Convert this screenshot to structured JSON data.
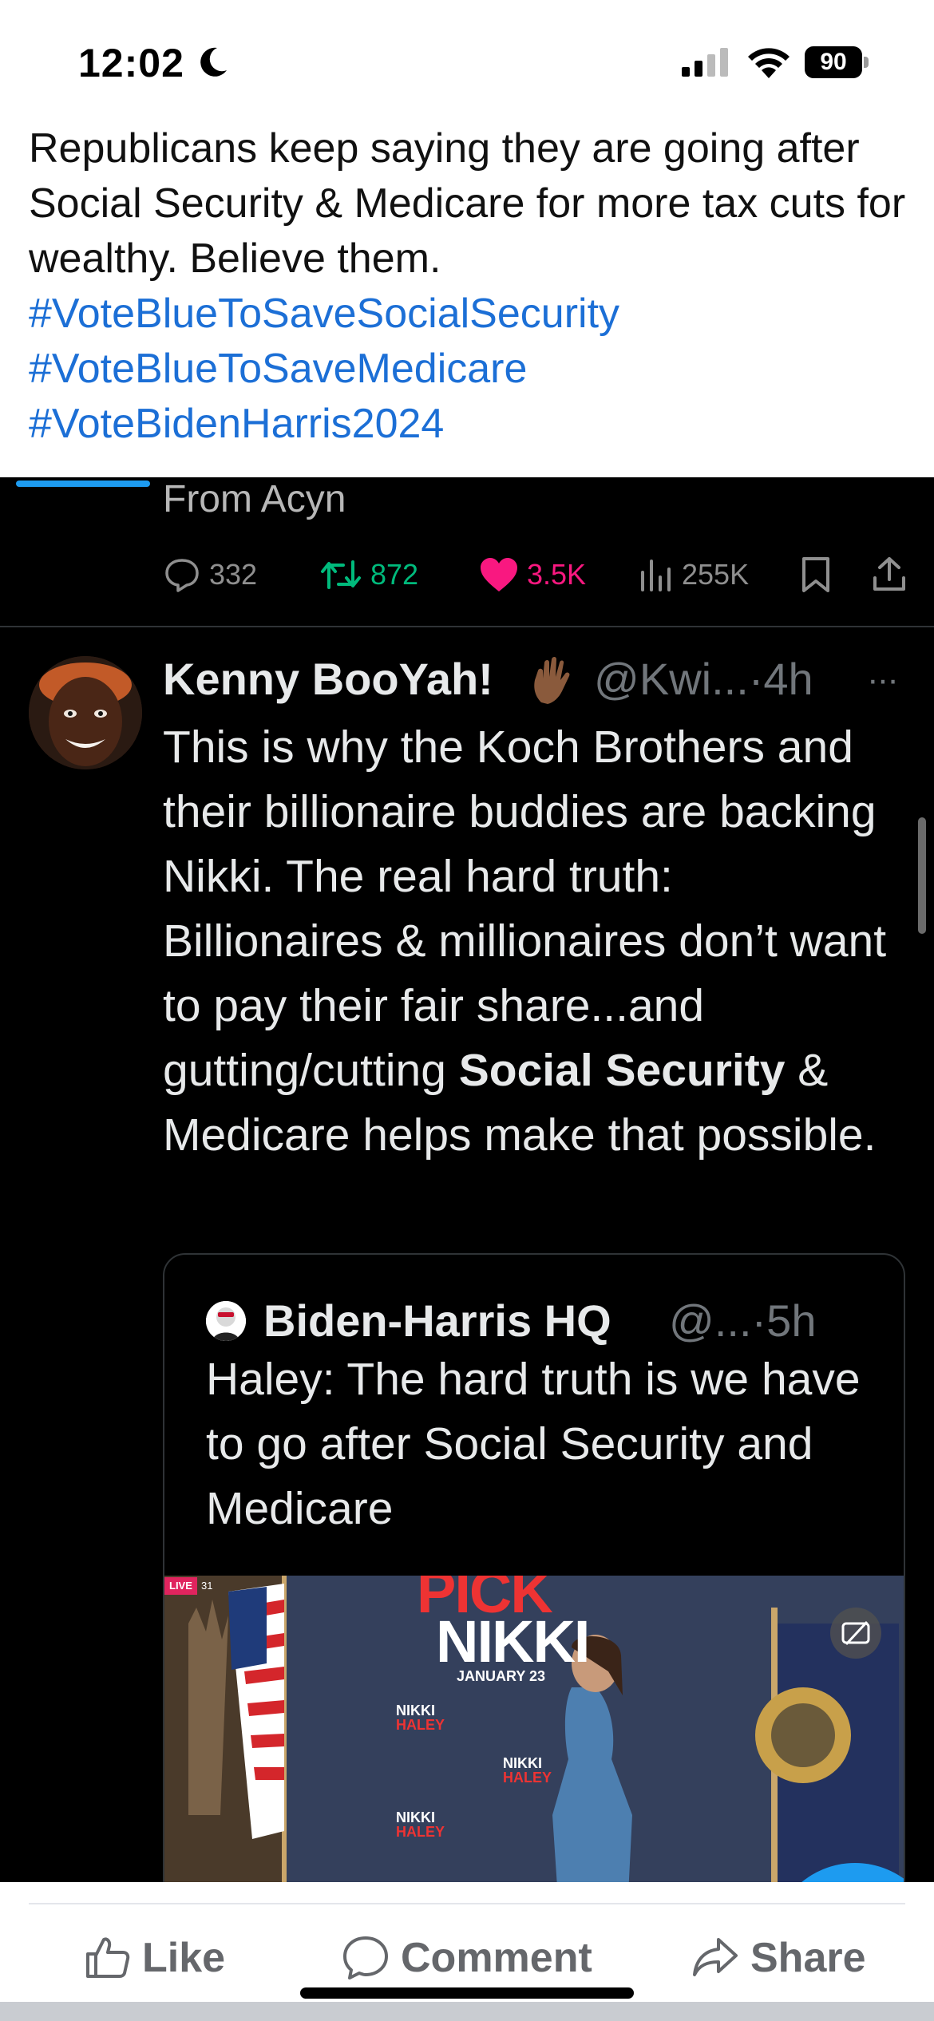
{
  "status_bar": {
    "time": "12:02",
    "battery_percent": "90"
  },
  "post": {
    "text": "Republicans keep saying they are going after Social Security & Medicare for more tax cuts for wealthy. Believe them.",
    "hashtags": [
      "#VoteBlueToSaveSocialSecurity",
      "#VoteBlueToSaveMedicare",
      "#VoteBidenHarris2024"
    ]
  },
  "tweet_screenshot": {
    "prev_tweet_from": "From Acyn",
    "actions": {
      "replies": "332",
      "retweets": "872",
      "likes": "3.5K",
      "views": "255K"
    },
    "tweet": {
      "name": "Kenny BooYah!",
      "handle_time": "@Kwi...·4h",
      "more": "···",
      "body_part1": "This is why the Koch Brothers and their billionaire buddies are backing Nikki. The real hard truth: Billionaires & millionaires don’t want to pay their fair share...and gutting/cutting ",
      "body_bold": "Social Security",
      "body_part2": " & Medicare helps make that possible."
    },
    "quote": {
      "name": "Biden-Harris HQ",
      "handle_time": "@...·5h",
      "text": "Haley: The hard truth is we have to go after Social Security and Medicare",
      "media": {
        "live_label": "LIVE",
        "viewer_count": "31",
        "sign_pick": "PICK",
        "sign_nikki": "NIKKI",
        "sign_date": "JANUARY 23",
        "small_sign_top": "NIKKI",
        "small_sign_bottom": "HALEY"
      }
    }
  },
  "bottom_bar": {
    "like_label": "Like",
    "comment_label": "Comment",
    "share_label": "Share"
  },
  "colors": {
    "hashtag": "#1c6fd6",
    "retweet": "#00ba7c",
    "like": "#f91880",
    "twitter_bg": "#000000",
    "action_gray": "#65676b"
  }
}
